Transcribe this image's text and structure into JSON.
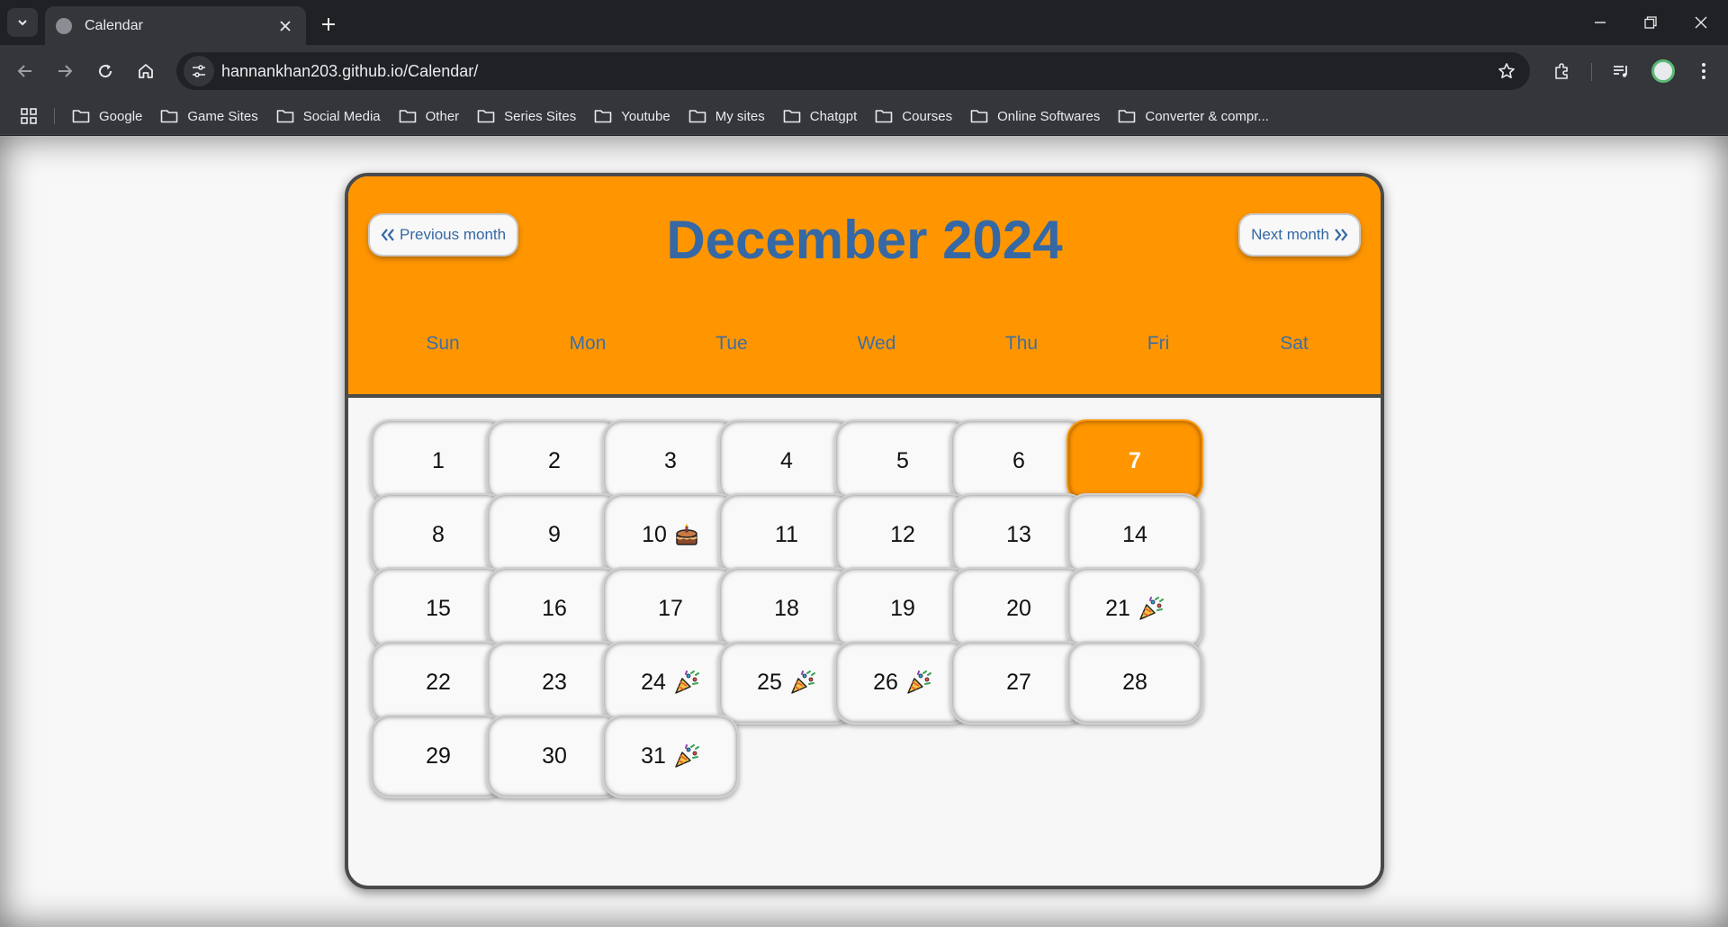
{
  "browser": {
    "tab_title": "Calendar",
    "url": "hannankhan203.github.io/Calendar/",
    "bookmarks": [
      "Google",
      "Game Sites",
      "Social Media",
      "Other",
      "Series Sites",
      "Youtube",
      "My sites",
      "Chatgpt",
      "Courses",
      "Online Softwares",
      "Converter & compr..."
    ]
  },
  "calendar": {
    "title": "December 2024",
    "prev_label": "Previous month",
    "next_label": "Next month",
    "weekdays": [
      "Sun",
      "Mon",
      "Tue",
      "Wed",
      "Thu",
      "Fri",
      "Sat"
    ],
    "first_weekday_index": 0,
    "today": 7,
    "days": [
      {
        "n": 1
      },
      {
        "n": 2
      },
      {
        "n": 3
      },
      {
        "n": 4
      },
      {
        "n": 5
      },
      {
        "n": 6
      },
      {
        "n": 7
      },
      {
        "n": 8
      },
      {
        "n": 9
      },
      {
        "n": 10,
        "icon": "cake-icon"
      },
      {
        "n": 11
      },
      {
        "n": 12
      },
      {
        "n": 13
      },
      {
        "n": 14
      },
      {
        "n": 15
      },
      {
        "n": 16
      },
      {
        "n": 17
      },
      {
        "n": 18
      },
      {
        "n": 19
      },
      {
        "n": 20
      },
      {
        "n": 21,
        "icon": "party-popper-icon"
      },
      {
        "n": 22
      },
      {
        "n": 23
      },
      {
        "n": 24,
        "icon": "party-popper-icon"
      },
      {
        "n": 25,
        "icon": "party-popper-icon"
      },
      {
        "n": 26,
        "icon": "party-popper-icon"
      },
      {
        "n": 27
      },
      {
        "n": 28
      },
      {
        "n": 29
      },
      {
        "n": 30
      },
      {
        "n": 31,
        "icon": "party-popper-icon"
      }
    ]
  },
  "colors": {
    "header": "#ff9600",
    "today": "#ff9600",
    "accent_text": "#3568a4",
    "cell": "#f9f9f9"
  }
}
